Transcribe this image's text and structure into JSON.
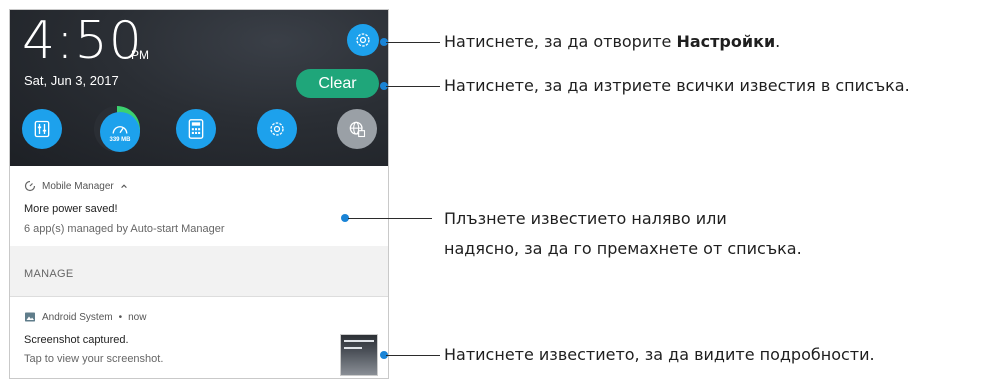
{
  "status_area": {
    "time": "4:50",
    "ampm": "PM",
    "date": "Sat, Jun 3, 2017",
    "clear_label": "Clear"
  },
  "quick_tiles": [
    {
      "icon": "audio-wizard-icon"
    },
    {
      "icon": "boost-icon",
      "memory": "339 MB"
    },
    {
      "icon": "calculator-icon"
    },
    {
      "icon": "settings-gear-icon"
    },
    {
      "icon": "globe-network-icon"
    }
  ],
  "notifications": [
    {
      "app": "Mobile Manager",
      "title": "More power saved!",
      "text": "6 app(s) managed by Auto-start Manager",
      "action": "MANAGE"
    },
    {
      "app": "Android System",
      "time": "now",
      "title": "Screenshot captured.",
      "text": "Tap to view your screenshot."
    }
  ],
  "callouts": {
    "settings_prefix": "Натиснете, за да отворите ",
    "settings_bold": "Настройки",
    "settings_suffix": ".",
    "clear": "Натиснете, за да изтриете всички известия в списъка.",
    "swipe_line1": "Плъзнете известието наляво или",
    "swipe_line2": "надясно, за да го премахнете от списъка.",
    "tap": "Натиснете известието, за да видите подробности."
  },
  "colors": {
    "accent_blue": "#1da1ec",
    "clear_green": "#1fa67a",
    "boost_green": "#3bd16f",
    "dot_blue": "#1a84d6"
  }
}
